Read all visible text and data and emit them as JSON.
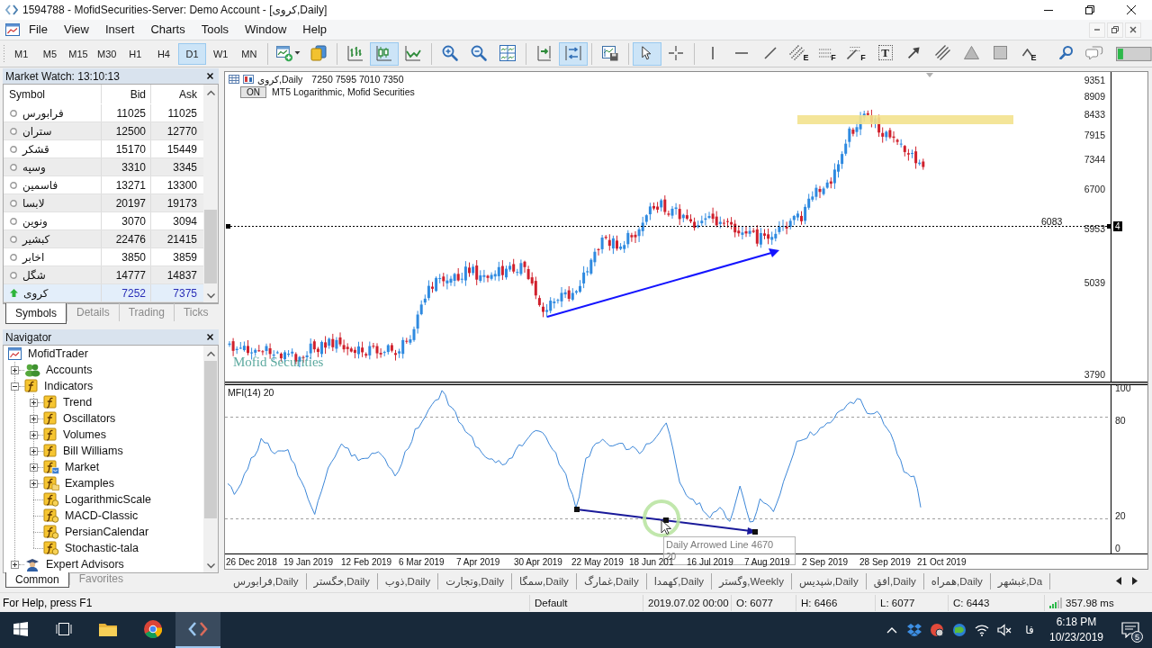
{
  "window": {
    "title": "1594788 - MofidSecurities-Server: Demo Account - [کروی,Daily]"
  },
  "menu": [
    "File",
    "View",
    "Insert",
    "Charts",
    "Tools",
    "Window",
    "Help"
  ],
  "toolbar": {
    "timeframes": [
      {
        "label": "M1",
        "selected": false
      },
      {
        "label": "M5",
        "selected": false
      },
      {
        "label": "M15",
        "selected": false
      },
      {
        "label": "M30",
        "selected": false
      },
      {
        "label": "H1",
        "selected": false
      },
      {
        "label": "H4",
        "selected": false
      },
      {
        "label": "D1",
        "selected": true
      },
      {
        "label": "W1",
        "selected": false
      },
      {
        "label": "MN",
        "selected": false
      }
    ],
    "tool_groups": [
      [
        {
          "kind": "new-chart",
          "pressed": false
        },
        {
          "kind": "tiles",
          "pressed": false
        }
      ],
      [
        {
          "kind": "bars",
          "pressed": false
        },
        {
          "kind": "candles",
          "pressed": true
        },
        {
          "kind": "line",
          "pressed": false
        }
      ],
      [
        {
          "kind": "zoom-in",
          "pressed": false
        },
        {
          "kind": "zoom-out",
          "pressed": false
        },
        {
          "kind": "tile",
          "pressed": false
        }
      ],
      [
        {
          "kind": "shift",
          "pressed": false
        },
        {
          "kind": "autoscroll",
          "pressed": true
        }
      ],
      [
        {
          "kind": "templates",
          "pressed": false
        }
      ],
      [
        {
          "kind": "cursor",
          "pressed": true
        },
        {
          "kind": "crosshair",
          "pressed": false
        }
      ],
      [
        {
          "kind": "vline",
          "pressed": false
        },
        {
          "kind": "hline",
          "pressed": false
        },
        {
          "kind": "trend",
          "pressed": false
        },
        {
          "kind": "fibo-channel",
          "pressed": false,
          "letter": "E"
        },
        {
          "kind": "fibo-levels",
          "pressed": false,
          "letter": "F"
        },
        {
          "kind": "fibo-fan",
          "pressed": false,
          "letter": "F"
        },
        {
          "kind": "text",
          "pressed": false,
          "letter": "T"
        },
        {
          "kind": "arrow",
          "pressed": false
        },
        {
          "kind": "channel",
          "pressed": false
        },
        {
          "kind": "triangle",
          "pressed": false
        },
        {
          "kind": "rectangle",
          "pressed": false
        },
        {
          "kind": "wave",
          "pressed": false,
          "letter": "E"
        }
      ],
      [
        {
          "kind": "search",
          "pressed": false
        },
        {
          "kind": "chat",
          "pressed": false
        }
      ]
    ]
  },
  "market_watch": {
    "title": "Market Watch: 13:10:13",
    "columns": [
      "Symbol",
      "Bid",
      "Ask"
    ],
    "rows": [
      {
        "symbol": "فرابورس",
        "bid": "11025",
        "ask": "11025",
        "kind": "idle",
        "selected": false
      },
      {
        "symbol": "ستران",
        "bid": "12500",
        "ask": "12770",
        "kind": "idle",
        "selected": false
      },
      {
        "symbol": "قشکر",
        "bid": "15170",
        "ask": "15449",
        "kind": "idle",
        "selected": false
      },
      {
        "symbol": "وسپه",
        "bid": "3310",
        "ask": "3345",
        "kind": "idle",
        "selected": false
      },
      {
        "symbol": "فاسمین",
        "bid": "13271",
        "ask": "13300",
        "kind": "idle",
        "selected": false
      },
      {
        "symbol": "لابسا",
        "bid": "20197",
        "ask": "19173",
        "kind": "idle",
        "selected": false
      },
      {
        "symbol": "ونوین",
        "bid": "3070",
        "ask": "3094",
        "kind": "idle",
        "selected": false
      },
      {
        "symbol": "کبشیر",
        "bid": "22476",
        "ask": "21415",
        "kind": "idle",
        "selected": false
      },
      {
        "symbol": "اخابر",
        "bid": "3850",
        "ask": "3859",
        "kind": "idle",
        "selected": false
      },
      {
        "symbol": "شگل",
        "bid": "14777",
        "ask": "14837",
        "kind": "idle",
        "selected": false
      },
      {
        "symbol": "کروی",
        "bid": "7252",
        "ask": "7375",
        "kind": "up",
        "selected": true
      }
    ],
    "tabs": [
      {
        "label": "Symbols",
        "selected": true
      },
      {
        "label": "Details",
        "selected": false
      },
      {
        "label": "Trading",
        "selected": false
      },
      {
        "label": "Ticks",
        "selected": false
      }
    ]
  },
  "navigator": {
    "title": "Navigator",
    "tree": [
      {
        "label": "MofidTrader",
        "kind": "terminal",
        "children": [
          {
            "label": "Accounts",
            "kind": "accounts",
            "expanded": false
          },
          {
            "label": "Indicators",
            "kind": "group",
            "expanded": true,
            "children": [
              {
                "label": "Trend",
                "kind": "group",
                "expanded": false
              },
              {
                "label": "Oscillators",
                "kind": "group",
                "expanded": false
              },
              {
                "label": "Volumes",
                "kind": "group",
                "expanded": false
              },
              {
                "label": "Bill Williams",
                "kind": "group",
                "expanded": false
              },
              {
                "label": "Market",
                "kind": "market",
                "expanded": false
              },
              {
                "label": "Examples",
                "kind": "examples",
                "expanded": false
              },
              {
                "label": "LogarithmicScale",
                "kind": "indicator"
              },
              {
                "label": "MACD-Classic",
                "kind": "indicator"
              },
              {
                "label": "PersianCalendar",
                "kind": "indicator"
              },
              {
                "label": "Stochastic-tala",
                "kind": "indicator"
              }
            ]
          },
          {
            "label": "Expert Advisors",
            "kind": "experts",
            "expanded": false
          }
        ]
      }
    ],
    "tabs": [
      {
        "label": "Common",
        "selected": true
      },
      {
        "label": "Favorites",
        "selected": false
      }
    ]
  },
  "chart": {
    "symbol": "کروی,Daily",
    "ohlc": "7250 7595 7010 7350",
    "toggle": "ON",
    "indicator_name": "MT5 Logarithmic, Mofid Securities",
    "logo": "Mofid Securities",
    "line_price": "6083",
    "price_tag": "4",
    "price_axis": [
      "9351",
      "8909",
      "8433",
      "7915",
      "7344",
      "6700",
      "5953",
      "5039",
      "3790"
    ]
  },
  "indicator": {
    "label": "MFI(14) 20",
    "axis": [
      "100",
      "80",
      "20",
      "0"
    ]
  },
  "time_axis": [
    "26 Dec 2018",
    "19 Jan 2019",
    "12 Feb 2019",
    "6 Mar 2019",
    "7 Apr 2019",
    "30 Apr 2019",
    "22 May 2019",
    "18 Jun 201",
    "16 Jul 2019",
    "7 Aug 2019",
    "2 Sep 2019",
    "28 Sep 2019",
    "21 Oct 2019"
  ],
  "tooltip": {
    "title": "Daily Arrowed Line 4670",
    "value": "20"
  },
  "chart_tabs": [
    {
      "label": "فرابورس,Daily",
      "selected": false
    },
    {
      "label": "خگستر,Daily",
      "selected": false
    },
    {
      "label": "ذوب,Daily",
      "selected": false
    },
    {
      "label": "وتجارت,Daily",
      "selected": false
    },
    {
      "label": "سمگا,Daily",
      "selected": false
    },
    {
      "label": "غمارگ,Daily",
      "selected": false
    },
    {
      "label": "کهمدا,Daily",
      "selected": false
    },
    {
      "label": "وگستر,Weekly",
      "selected": false
    },
    {
      "label": "شپدیس,Daily",
      "selected": false
    },
    {
      "label": "افق,Daily",
      "selected": false
    },
    {
      "label": "همراه,Daily",
      "selected": false
    },
    {
      "label": "غبشهر,Da",
      "selected": false
    }
  ],
  "status_bar": {
    "help": "For Help, press F1",
    "profile": "Default",
    "time": "2019.07.02 00:00",
    "open": "O: 6077",
    "high": "H: 6466",
    "low": "L: 6077",
    "close": "C: 6443",
    "ping": "357.98 ms"
  },
  "taskbar": {
    "apps": [
      {
        "kind": "folder",
        "selected": false
      },
      {
        "kind": "browser",
        "selected": false
      },
      {
        "kind": "terminal",
        "selected": true
      }
    ],
    "language": "فا",
    "time": "6:18 PM",
    "date": "10/23/2019",
    "notifications": "5"
  }
}
